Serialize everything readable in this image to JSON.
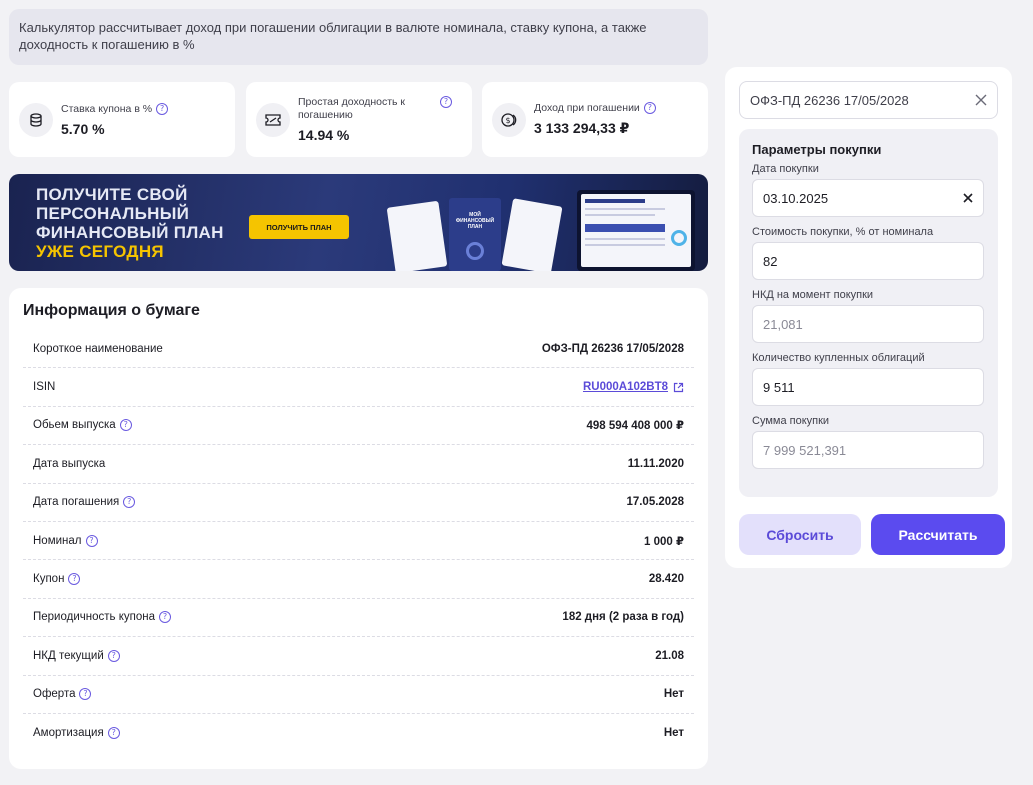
{
  "description": "Калькулятор рассчитывает доход при погашении облигации в валюте номинала, ставку купона, а также доходность к погашению в %",
  "stats": [
    {
      "label": "Ставка купона в %",
      "value": "5.70 %"
    },
    {
      "label": "Простая доходность к погашению",
      "value": "14.94 %"
    },
    {
      "label": "Доход при погашении",
      "value": "3 133 294,33 ₽"
    }
  ],
  "promo": {
    "line1": "ПОЛУЧИТЕ СВОЙ",
    "line2": "ПЕРСОНАЛЬНЫЙ",
    "line3": "ФИНАНСОВЫЙ ПЛАН",
    "line4": "УЖЕ СЕГОДНЯ",
    "button": "ПОЛУЧИТЬ ПЛАН",
    "doc_title": "МОЙ ФИНАНСОВЫЙ ПЛАН"
  },
  "info": {
    "title": "Информация о бумаге",
    "rows": [
      {
        "key": "Короткое наименование",
        "value": "ОФЗ-ПД 26236 17/05/2028"
      },
      {
        "key": "ISIN",
        "value": "RU000A102BT8"
      },
      {
        "key": "Обьем выпуска",
        "value": "498 594 408 000 ₽"
      },
      {
        "key": "Дата выпуска",
        "value": "11.11.2020"
      },
      {
        "key": "Дата погашения",
        "value": "17.05.2028"
      },
      {
        "key": "Номинал",
        "value": "1 000 ₽"
      },
      {
        "key": "Купон",
        "value": "28.420"
      },
      {
        "key": "Периодичность купона",
        "value": "182 дня (2 раза в год)"
      },
      {
        "key": "НКД текущий",
        "value": "21.08"
      },
      {
        "key": "Оферта",
        "value": "Нет"
      },
      {
        "key": "Амортизация",
        "value": "Нет"
      }
    ]
  },
  "form": {
    "search_value": "ОФЗ-ПД 26236 17/05/2028",
    "params_title": "Параметры покупки",
    "fields": [
      {
        "label": "Дата покупки",
        "value": "03.10.2025"
      },
      {
        "label": "Стоимость покупки, % от номинала",
        "value": "82"
      },
      {
        "label": "НКД на момент покупки",
        "value": "21,081"
      },
      {
        "label": "Количество купленных облигаций",
        "value": "9 511"
      },
      {
        "label": "Сумма покупки",
        "value": "7 999 521,391"
      }
    ],
    "reset_label": "Сбросить",
    "calc_label": "Рассчитать"
  },
  "colors": {
    "accent": "#5b4bef",
    "promo_yellow": "#f5c400"
  }
}
